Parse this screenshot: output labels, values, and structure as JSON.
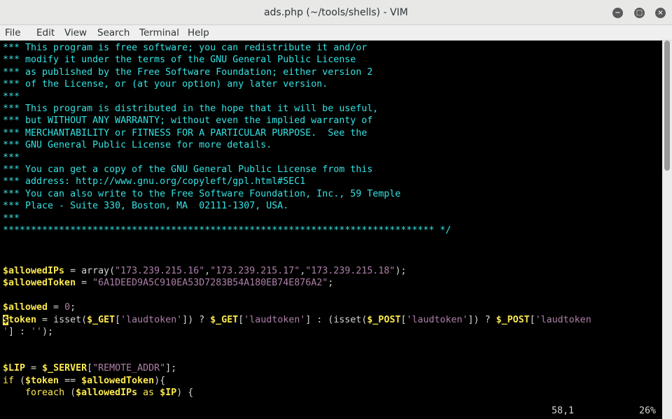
{
  "window": {
    "title": "ads.php (~/tools/shells) - VIM"
  },
  "menu": [
    "File",
    "Edit",
    "View",
    "Search",
    "Terminal",
    "Help"
  ],
  "window_controls": {
    "minimize": "−",
    "maximize": "□",
    "close": "×"
  },
  "editor": {
    "comment_lines": [
      "*** This program is free software; you can redistribute it and/or",
      "*** modify it under the terms of the GNU General Public License",
      "*** as published by the Free Software Foundation; either version 2",
      "*** of the License, or (at your option) any later version.",
      "***",
      "*** This program is distributed in the hope that it will be useful,",
      "*** but WITHOUT ANY WARRANTY; without even the implied warranty of",
      "*** MERCHANTABILITY or FITNESS FOR A PARTICULAR PURPOSE.  See the",
      "*** GNU General Public License for more details.",
      "***",
      "*** You can get a copy of the GNU General Public License from this",
      "*** address: http://www.gnu.org/copyleft/gpl.html#SEC1",
      "*** You can also write to the Free Software Foundation, Inc., 59 Temple",
      "*** Place - Suite 330, Boston, MA  02111-1307, USA.",
      "***",
      "***************************************************************************** */"
    ],
    "code": {
      "ips_var": "$allowedIPs",
      "ips_eq": " = array(",
      "ip1": "\"173.239.215.16\"",
      "ip2": "\"173.239.215.17\"",
      "ip3": "\"173.239.215.18\"",
      "comma": ",",
      "ips_end": ");",
      "token_var": "$allowedToken",
      "token_eq": " = ",
      "token_val": "\"6A1DEED9A5C910EA53D7283B54A180EB74E876A2\"",
      "semi": ";",
      "allowed_var": "$allowed",
      "allowed_eq": " = ",
      "allowed_val": "0",
      "cursor_char": "$",
      "tok_var": "token",
      "tok_t1": " = isset(",
      "get_var": "$_GET",
      "br_open": "[",
      "laud": "'laudtoken'",
      "br_close_paren": "]) ? ",
      "br_close_colon": "] : (isset(",
      "post_var": "$_POST",
      "br_close_q": "]) ? ",
      "laud_partial": "'laudtoken",
      "wrap_quote": "'",
      "wrap_rest": "] : ",
      "empty_str": "''",
      "wrap_end": ");",
      "lip_var": "$LIP",
      "lip_eq": " = ",
      "server_var": "$_SERVER",
      "remote_addr": "\"REMOTE_ADDR\"",
      "close_br_semi": "];",
      "if_kw": "if",
      "if_open": " (",
      "tok_full": "$token",
      "eqeq": " == ",
      "close_brace": "){",
      "foreach_indent": "    ",
      "foreach_kw": "foreach",
      "as_kw": " as ",
      "ip_var": "$IP",
      "foreach_end": ") {"
    }
  },
  "status": {
    "position": "58,1",
    "percent": "26%"
  },
  "colors": {
    "comment": "#34e2e2",
    "variable": "#fce94f",
    "string": "#ad7fa8",
    "background": "#000000"
  }
}
